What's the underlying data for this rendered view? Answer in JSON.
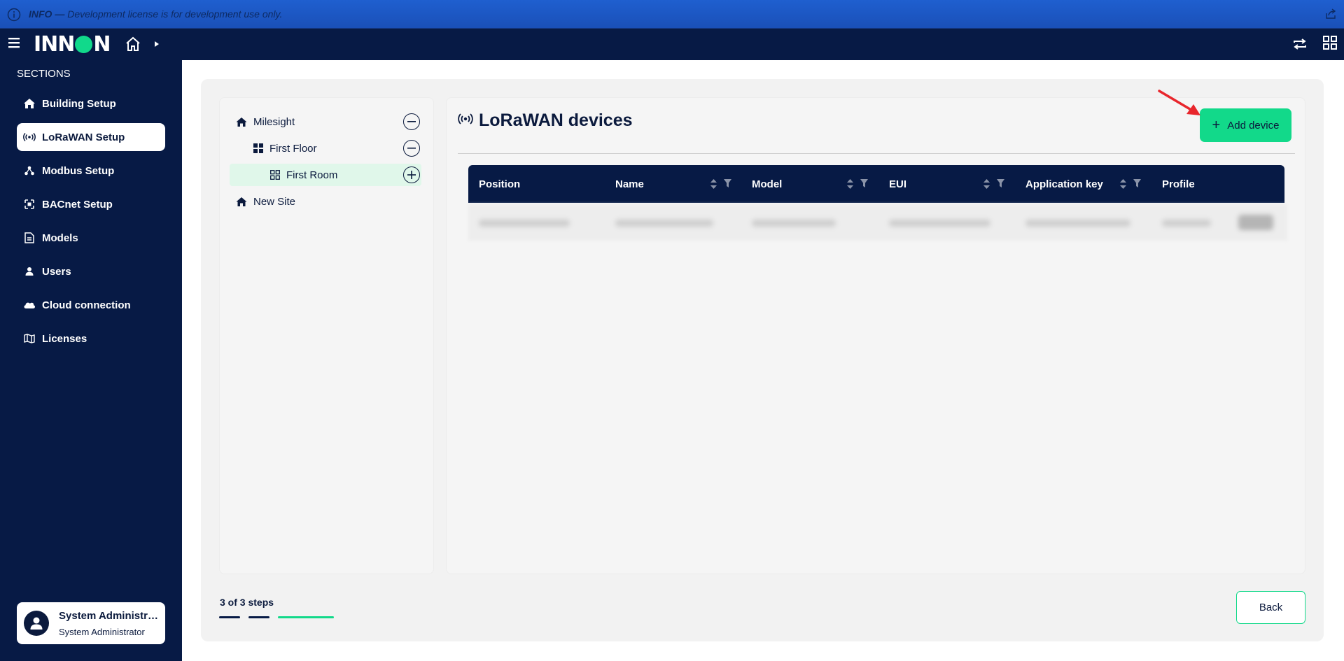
{
  "banner": {
    "level": "INFO",
    "separator": "—",
    "message": "Development license is for development use only."
  },
  "brand": {
    "logo_text_left": "INN",
    "logo_text_right": "N",
    "accent": "#11d98b",
    "navy": "#071a45"
  },
  "sidebar": {
    "title": "SECTIONS",
    "items": [
      {
        "label": "Building Setup",
        "icon": "home-icon"
      },
      {
        "label": "LoRaWAN Setup",
        "icon": "broadcast-icon",
        "active": true
      },
      {
        "label": "Modbus Setup",
        "icon": "network-icon"
      },
      {
        "label": "BACnet Setup",
        "icon": "bacnet-icon"
      },
      {
        "label": "Models",
        "icon": "document-icon"
      },
      {
        "label": "Users",
        "icon": "user-icon"
      },
      {
        "label": "Cloud connection",
        "icon": "cloud-icon"
      },
      {
        "label": "Licenses",
        "icon": "map-icon"
      }
    ],
    "user": {
      "name": "System Administrator",
      "role": "System Administrator"
    }
  },
  "tree": {
    "nodes": [
      {
        "label": "Milesight",
        "level": 0,
        "icon": "home-icon",
        "action": "collapse"
      },
      {
        "label": "First Floor",
        "level": 1,
        "icon": "floor-grid-icon",
        "action": "collapse"
      },
      {
        "label": "First Room",
        "level": 2,
        "icon": "room-grid-icon",
        "action": "add",
        "selected": true
      },
      {
        "label": "New Site",
        "level": 0,
        "icon": "home-icon"
      }
    ]
  },
  "main": {
    "title": "LoRaWAN devices",
    "add_button": "Add device",
    "table": {
      "columns": [
        {
          "label": "Position",
          "sortable": false
        },
        {
          "label": "Name",
          "sortable": true
        },
        {
          "label": "Model",
          "sortable": true
        },
        {
          "label": "EUI",
          "sortable": true
        },
        {
          "label": "Application key",
          "sortable": true
        },
        {
          "label": "Profile",
          "sortable": false
        }
      ]
    }
  },
  "footer": {
    "steps_label": "3 of 3 steps",
    "back_button": "Back"
  }
}
